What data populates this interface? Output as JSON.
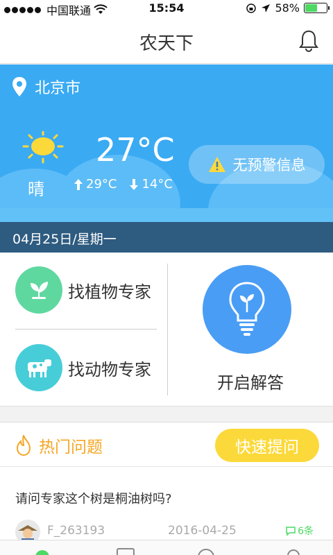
{
  "status_bar": {
    "carrier": "中国联通",
    "time": "15:54",
    "battery": "58%",
    "battery_level": 0.58
  },
  "nav": {
    "title": "农天下"
  },
  "weather": {
    "city": "北京市",
    "condition": "晴",
    "temperature": "27°C",
    "high": "29°C",
    "low": "14°C",
    "alert": "无预警信息",
    "date": "04月25日/星期一"
  },
  "experts": {
    "plant": "找植物专家",
    "animal": "找动物专家",
    "answer": "开启解答"
  },
  "hot": {
    "title": "热门问题",
    "quick_button": "快速提问",
    "question": "请问专家这个树是桐油树吗?",
    "user": "F_263193",
    "date": "2016-04-25",
    "answers": "6条"
  },
  "colors": {
    "accent": "#3aaaf3",
    "date_bar": "#2e5b80",
    "quick": "#fcd93a",
    "hot": "#f5a623"
  }
}
